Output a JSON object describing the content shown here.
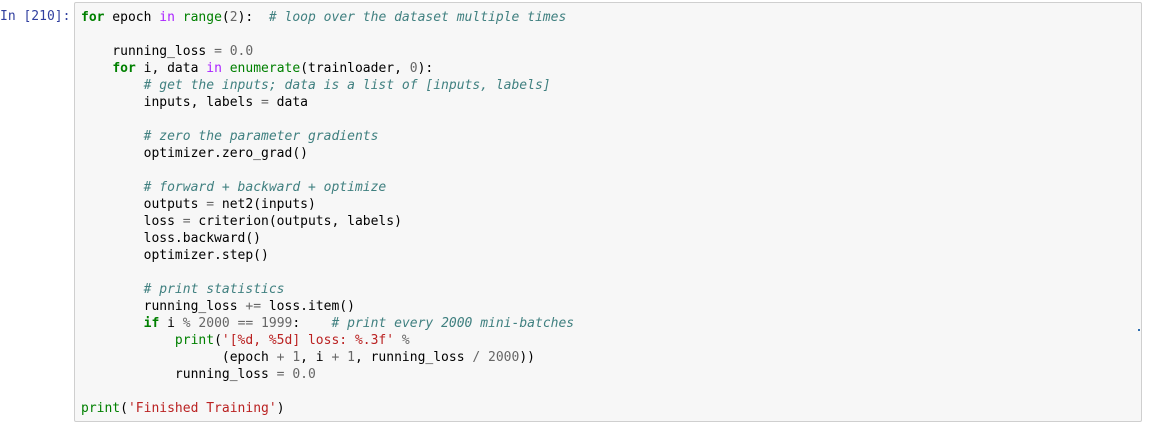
{
  "cell": {
    "prompt": "In [210]:",
    "lines": [
      [
        [
          "kw",
          "for"
        ],
        [
          "p",
          " epoch "
        ],
        [
          "ow",
          "in"
        ],
        [
          "p",
          " "
        ],
        [
          "bi",
          "range"
        ],
        [
          "p",
          "("
        ],
        [
          "num",
          "2"
        ],
        [
          "p",
          "):  "
        ],
        [
          "cm",
          "# loop over the dataset multiple times"
        ]
      ],
      [],
      [
        [
          "p",
          "    running_loss "
        ],
        [
          "op",
          "="
        ],
        [
          "p",
          " "
        ],
        [
          "num",
          "0.0"
        ]
      ],
      [
        [
          "p",
          "    "
        ],
        [
          "kw",
          "for"
        ],
        [
          "p",
          " i, data "
        ],
        [
          "ow",
          "in"
        ],
        [
          "p",
          " "
        ],
        [
          "bi",
          "enumerate"
        ],
        [
          "p",
          "(trainloader, "
        ],
        [
          "num",
          "0"
        ],
        [
          "p",
          "):"
        ]
      ],
      [
        [
          "p",
          "        "
        ],
        [
          "cm",
          "# get the inputs; data is a list of [inputs, labels]"
        ]
      ],
      [
        [
          "p",
          "        inputs, labels "
        ],
        [
          "op",
          "="
        ],
        [
          "p",
          " data"
        ]
      ],
      [],
      [
        [
          "p",
          "        "
        ],
        [
          "cm",
          "# zero the parameter gradients"
        ]
      ],
      [
        [
          "p",
          "        optimizer.zero_grad()"
        ]
      ],
      [],
      [
        [
          "p",
          "        "
        ],
        [
          "cm",
          "# forward + backward + optimize"
        ]
      ],
      [
        [
          "p",
          "        outputs "
        ],
        [
          "op",
          "="
        ],
        [
          "p",
          " net2(inputs)"
        ]
      ],
      [
        [
          "p",
          "        loss "
        ],
        [
          "op",
          "="
        ],
        [
          "p",
          " criterion(outputs, labels)"
        ]
      ],
      [
        [
          "p",
          "        loss.backward()"
        ]
      ],
      [
        [
          "p",
          "        optimizer.step()"
        ]
      ],
      [],
      [
        [
          "p",
          "        "
        ],
        [
          "cm",
          "# print statistics"
        ]
      ],
      [
        [
          "p",
          "        running_loss "
        ],
        [
          "op",
          "+="
        ],
        [
          "p",
          " loss.item()"
        ]
      ],
      [
        [
          "p",
          "        "
        ],
        [
          "kw",
          "if"
        ],
        [
          "p",
          " i "
        ],
        [
          "op",
          "%"
        ],
        [
          "p",
          " "
        ],
        [
          "num",
          "2000"
        ],
        [
          "p",
          " "
        ],
        [
          "op",
          "=="
        ],
        [
          "p",
          " "
        ],
        [
          "num",
          "1999"
        ],
        [
          "p",
          ":    "
        ],
        [
          "cm",
          "# print every 2000 mini-batches"
        ]
      ],
      [
        [
          "p",
          "            "
        ],
        [
          "bi",
          "print"
        ],
        [
          "p",
          "("
        ],
        [
          "str",
          "'[%d, %5d] loss: %.3f'"
        ],
        [
          "p",
          " "
        ],
        [
          "op",
          "%"
        ]
      ],
      [
        [
          "p",
          "                  (epoch "
        ],
        [
          "op",
          "+"
        ],
        [
          "p",
          " "
        ],
        [
          "num",
          "1"
        ],
        [
          "p",
          ", i "
        ],
        [
          "op",
          "+"
        ],
        [
          "p",
          " "
        ],
        [
          "num",
          "1"
        ],
        [
          "p",
          ", running_loss "
        ],
        [
          "op",
          "/"
        ],
        [
          "p",
          " "
        ],
        [
          "num",
          "2000"
        ],
        [
          "p",
          "))"
        ]
      ],
      [
        [
          "p",
          "            running_loss "
        ],
        [
          "op",
          "="
        ],
        [
          "p",
          " "
        ],
        [
          "num",
          "0.0"
        ]
      ],
      [],
      [
        [
          "bi",
          "print"
        ],
        [
          "p",
          "("
        ],
        [
          "str",
          "'Finished Training'"
        ],
        [
          "p",
          ")"
        ]
      ]
    ]
  }
}
